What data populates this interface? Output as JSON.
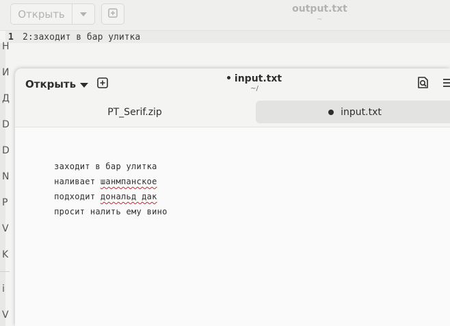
{
  "background_window": {
    "open_label": "Открыть",
    "title": "output.txt",
    "subtitle": "~",
    "line_number": "1",
    "line_text": "2:заходит в бар улитка",
    "side_letters": [
      "Н",
      "И",
      "Д",
      "D",
      "D",
      "N",
      "P",
      "V",
      "K",
      "i",
      "V"
    ]
  },
  "foreground_window": {
    "open_label": "Открыть",
    "title": "input.txt",
    "subtitle": "~/",
    "tabs": [
      {
        "label": "PT_Serif.zip"
      },
      {
        "label": "input.txt"
      }
    ],
    "lines": [
      {
        "before": "заходит в бар улитка",
        "misspelled": "",
        "after": ""
      },
      {
        "before": "наливает ",
        "misspelled": "шанмпанское",
        "after": ""
      },
      {
        "before": "подходит ",
        "misspelled": "дональд дак",
        "after": ""
      },
      {
        "before": "просит налить ему вино",
        "misspelled": "",
        "after": ""
      }
    ]
  },
  "colors": {
    "spellcheck_underline": "#e01b24",
    "active_tab": "#e3e3e2"
  },
  "icons": {
    "dropdown": "chevron-down-icon",
    "new_tab": "new-tab-icon",
    "search": "search-icon",
    "menu": "hamburger-menu-icon"
  }
}
